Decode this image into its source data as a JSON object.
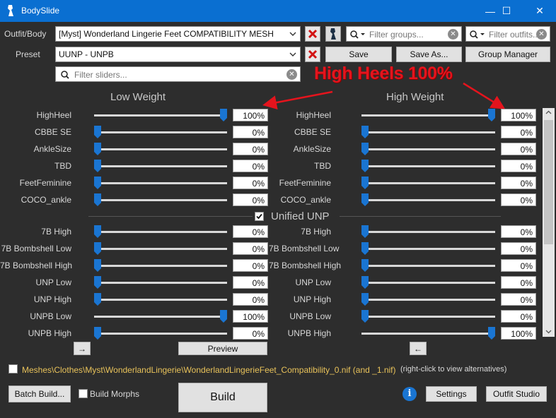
{
  "window": {
    "title": "BodySlide",
    "minimize_glyph": "—",
    "maximize_glyph": "☐",
    "close_glyph": "✕"
  },
  "outfit": {
    "label": "Outfit/Body",
    "value": "[Myst] Wonderland Lingerie Feet COMPATIBILITY MESH"
  },
  "preset": {
    "label": "Preset",
    "value": "UUNP - UNPB"
  },
  "filters": {
    "groups_placeholder": "Filter groups...",
    "outfits_placeholder": "Filter outfits...",
    "sliders_placeholder": "Filter sliders..."
  },
  "buttons": {
    "save": "Save",
    "save_as": "Save As...",
    "group_manager": "Group Manager",
    "preview": "Preview",
    "batch_build": "Batch Build...",
    "build": "Build",
    "settings": "Settings",
    "outfit_studio": "Outfit Studio",
    "arrow_right": "→",
    "arrow_left": "←"
  },
  "annotation": "High Heels 100%",
  "headings": {
    "low": "Low Weight",
    "high": "High Weight"
  },
  "group_label": "Unified UNP",
  "sliders": [
    {
      "name": "HighHeel",
      "low": "100%",
      "high": "100%",
      "low_pos": 1.0,
      "high_pos": 1.0
    },
    {
      "name": "CBBE SE",
      "low": "0%",
      "high": "0%",
      "low_pos": 0,
      "high_pos": 0
    },
    {
      "name": "AnkleSize",
      "low": "0%",
      "high": "0%",
      "low_pos": 0,
      "high_pos": 0
    },
    {
      "name": "TBD",
      "low": "0%",
      "high": "0%",
      "low_pos": 0,
      "high_pos": 0
    },
    {
      "name": "FeetFeminine",
      "low": "0%",
      "high": "0%",
      "low_pos": 0,
      "high_pos": 0
    },
    {
      "name": "COCO_ankle",
      "low": "0%",
      "high": "0%",
      "low_pos": 0,
      "high_pos": 0
    },
    {
      "name": "7B High",
      "low": "0%",
      "high": "0%",
      "low_pos": 0,
      "high_pos": 0
    },
    {
      "name": "7B Bombshell Low",
      "low": "0%",
      "high": "0%",
      "low_pos": 0,
      "high_pos": 0
    },
    {
      "name": "7B Bombshell High",
      "low": "0%",
      "high": "0%",
      "low_pos": 0,
      "high_pos": 0
    },
    {
      "name": "UNP Low",
      "low": "0%",
      "high": "0%",
      "low_pos": 0,
      "high_pos": 0
    },
    {
      "name": "UNP High",
      "low": "0%",
      "high": "0%",
      "low_pos": 0,
      "high_pos": 0
    },
    {
      "name": "UNPB Low",
      "low": "100%",
      "high": "0%",
      "low_pos": 1.0,
      "high_pos": 0
    },
    {
      "name": "UNPB High",
      "low": "0%",
      "high": "100%",
      "low_pos": 0,
      "high_pos": 1.0
    }
  ],
  "output_path": "Meshes\\Clothes\\Myst\\WonderlandLingerie\\WonderlandLingerieFeet_Compatibility_0.nif (and _1.nif)",
  "path_hint": "(right-click to view alternatives)",
  "build_morphs": "Build Morphs",
  "colors": {
    "titlebar": "#0a6fd1",
    "background": "#2d2d2d",
    "thumb": "#1a75d2",
    "annotation": "#e4141d",
    "path": "#e8c25a"
  }
}
